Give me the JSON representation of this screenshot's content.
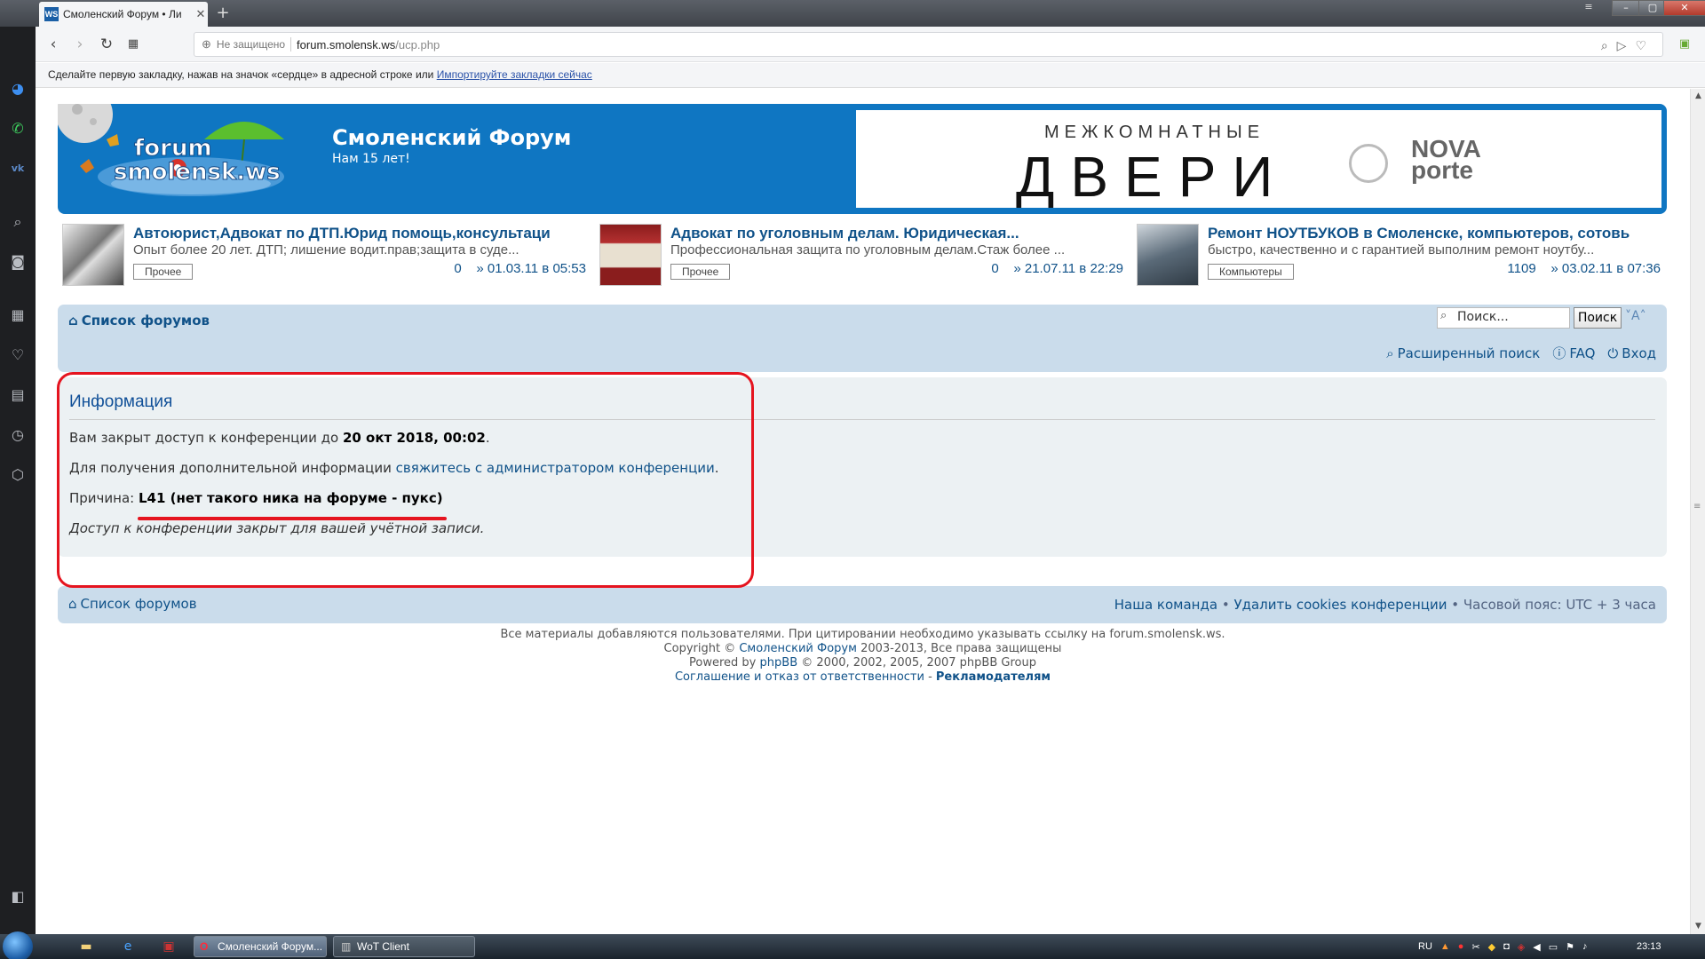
{
  "browser": {
    "tab_title": "Смоленский Форум • Ли",
    "tab_favicon": "WS",
    "security_label": "Не защищено",
    "url_host": "forum.smolensk.ws",
    "url_path": "/ucp.php",
    "bookmarks_hint": "Сделайте первую закладку, нажав на значок «сердце» в адресной строке или",
    "bookmarks_link": "Импортируйте закладки сейчас"
  },
  "header": {
    "site_title": "Смоленский Форум",
    "site_desc": "Нам 15 лет!",
    "logo_text_top": "forum",
    "logo_text_bottom": "smolensk.ws",
    "banner_top": "МЕЖКОМНАТНЫЕ",
    "banner_main": "ДВЕРИ",
    "banner_brand_1": "NOVA",
    "banner_brand_2": "porte"
  },
  "ads": [
    {
      "title": "Автоюрист,Адвокат по ДТП.Юрид помощь,консультаци",
      "desc": "Опыт более 20 лет. ДТП; лишение водит.прав;защита в суде...",
      "tag": "Прочее",
      "count": "0",
      "date": "» 01.03.11 в 05:53"
    },
    {
      "title": "Адвокат по уголовным делам. Юридическая...",
      "desc": "Профессиональная защита по уголовным делам.Стаж более ...",
      "tag": "Прочее",
      "count": "0",
      "date": "» 21.07.11 в 22:29"
    },
    {
      "title": "Ремонт НОУТБУКОВ в Смоленске, компьютеров, сотовь",
      "desc": "быстро, качественно и с гарантией выполним ремонт ноутбу...",
      "tag": "Компьютеры",
      "count": "1109",
      "date": "» 03.02.11 в 07:36"
    }
  ],
  "navbar": {
    "home_label": "Список форумов",
    "search_placeholder": "Поиск...",
    "search_button": "Поиск",
    "font_size_label": "˅A˄",
    "advanced_search": "Расширенный поиск",
    "faq": "FAQ",
    "login": "Вход"
  },
  "info": {
    "title": "Информация",
    "line1_prefix": "Вам закрыт доступ к конференции до",
    "line1_date": "20 окт 2018, 00:02",
    "line1_suffix": ".",
    "line2_prefix": "Для получения дополнительной информации",
    "line2_link": "свяжитесь с администратором конференции",
    "line2_suffix": ".",
    "reason_label": "Причина:",
    "reason_value": "L41 (нет такого ника на форуме - пукс)",
    "closed_note": "Доступ к конференции закрыт для вашей учётной записи."
  },
  "footer": {
    "home_label": "Список форумов",
    "team": "Наша команда",
    "delete_cookies": "Удалить cookies конференции",
    "timezone": "Часовой пояс: UTC + 3 часа",
    "bullet": " • ",
    "line1": "Все материалы добавляются пользователями. При цитировании необходимо указывать ссылку на forum.smolensk.ws.",
    "copy_prefix": "Copyright ©",
    "copy_link": "Смоленский Форум",
    "copy_suffix": "2003-2013, Все права защищены",
    "powered_prefix": "Powered by",
    "powered_link": "phpBB",
    "powered_suffix": "© 2000, 2002, 2005, 2007 phpBB Group",
    "terms": "Соглашение и отказ от ответственности",
    "dash": " - ",
    "advertisers": "Рекламодателям"
  },
  "taskbar": {
    "task_opera": "Смоленский Форум...",
    "task_wot": "WoT Client",
    "lang": "RU",
    "clock": "23:13"
  },
  "colors": {
    "accent_red": "#e5141f",
    "link_blue": "#105289",
    "header_blue": "#0f76c2"
  }
}
